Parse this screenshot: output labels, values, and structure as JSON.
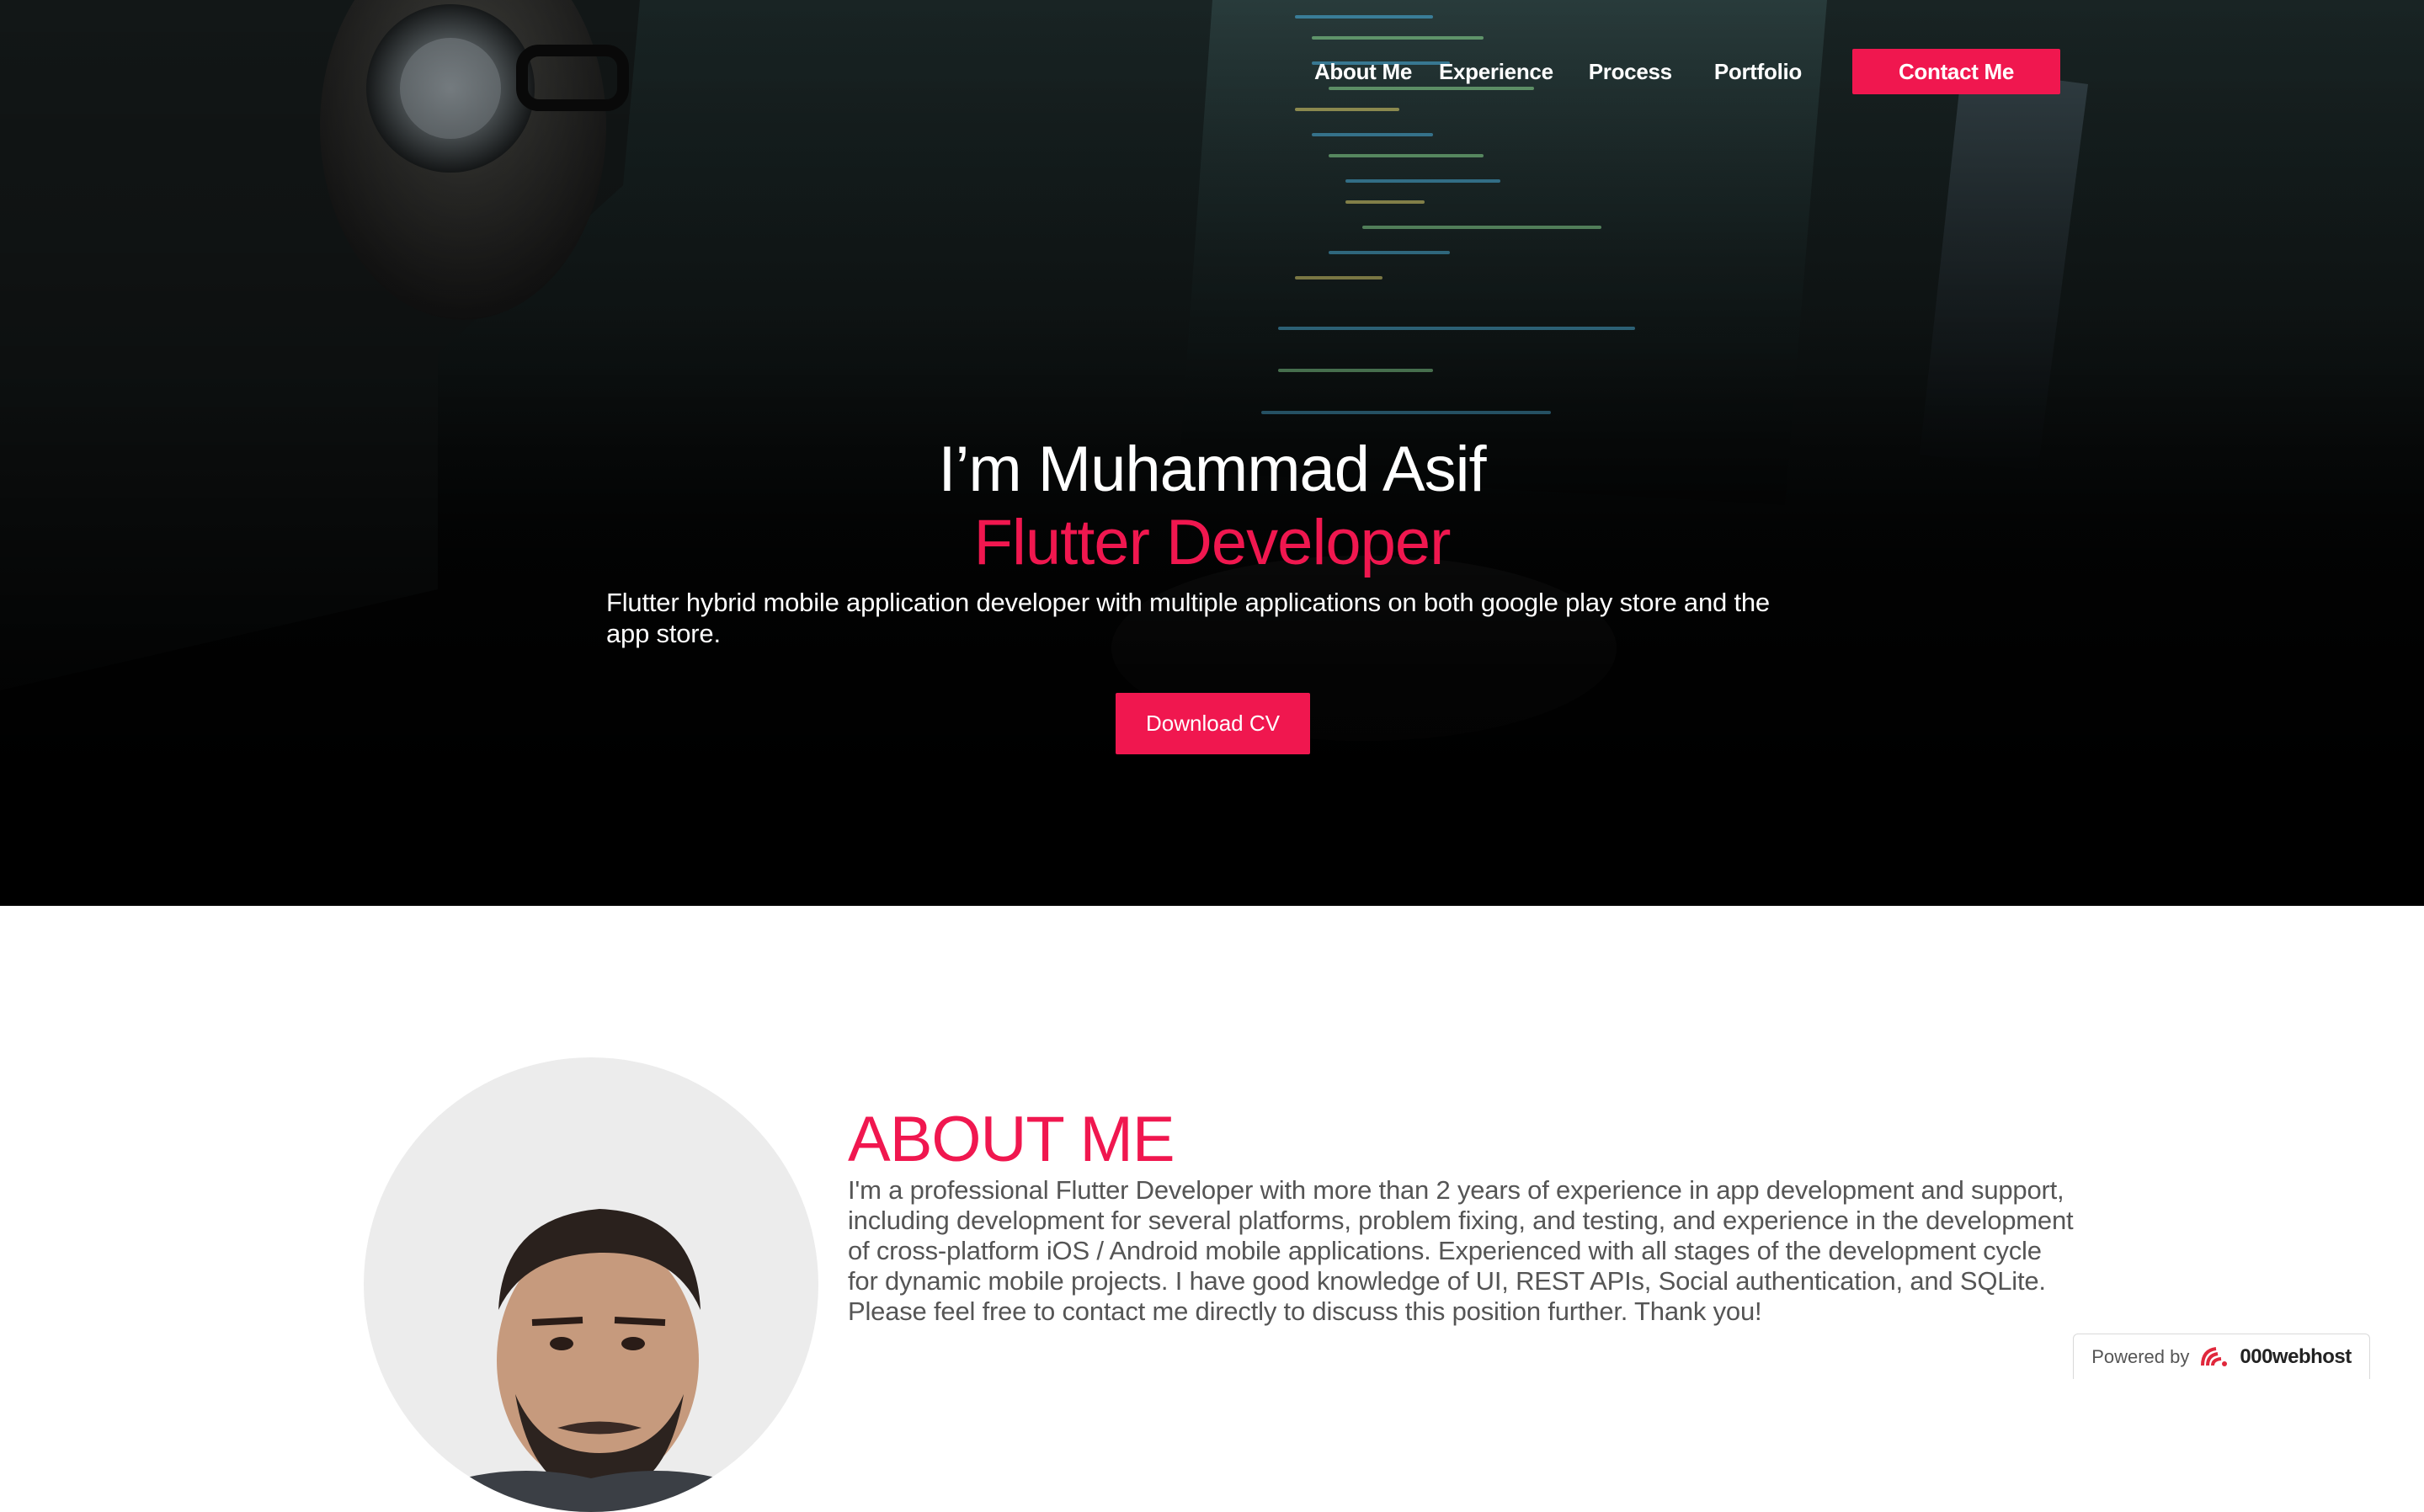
{
  "nav": {
    "links": [
      "About Me",
      "Experience",
      "Process",
      "Portfolio"
    ],
    "cta_label": "Contact Me"
  },
  "hero": {
    "title": "I’m Muhammad Asif",
    "subtitle": "Flutter Developer",
    "description": "Flutter hybrid mobile application developer with multiple applications on both google play store and the app store.",
    "cv_button_label": "Download CV"
  },
  "about": {
    "heading": "ABOUT ME",
    "text": "I'm a professional Flutter Developer with more than 2 years of experience in app development and support, including development for several platforms, problem fixing, and testing, and experience in the development of cross-platform iOS / Android mobile applications. Experienced with all stages of the development cycle for dynamic mobile projects. I have good knowledge of UI, REST APIs, Social authentication, and SQLite. Please feel free to contact me directly to discuss this position further. Thank you!"
  },
  "footer_badge": {
    "label": "Powered by",
    "brand": "000webhost"
  },
  "colors": {
    "accent": "#f0174f",
    "hero_dark": "#020202",
    "text_grey": "#555555"
  },
  "icons": {
    "hero_background": "developer-at-computer-photo",
    "profile_photo": "profile-photo",
    "host_logo": "000webhost-logo"
  }
}
